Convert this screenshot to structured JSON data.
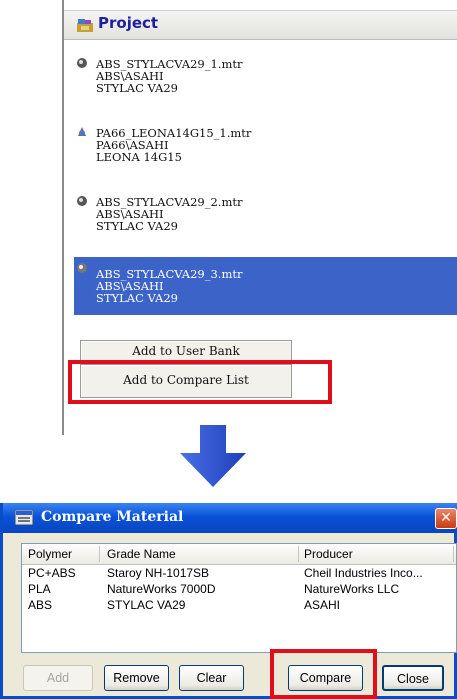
{
  "project": {
    "title": "Project",
    "items": [
      {
        "file": "ABS_STYLACVA29_1.mtr",
        "family": "ABS\\ASAHI",
        "grade": "STYLAC VA29",
        "selected": false
      },
      {
        "file": "PA66_LEONA14G15_1.mtr",
        "family": "PA66\\ASAHI",
        "grade": "LEONA 14G15",
        "selected": false
      },
      {
        "file": "ABS_STYLACVA29_2.mtr",
        "family": "ABS\\ASAHI",
        "grade": "STYLAC VA29",
        "selected": false
      },
      {
        "file": "ABS_STYLACVA29_3.mtr",
        "family": "ABS\\ASAHI",
        "grade": "STYLAC VA29",
        "selected": true
      }
    ],
    "context_menu": [
      "Add to User Bank",
      "Add to Compare List"
    ]
  },
  "dialog": {
    "title": "Compare Material",
    "close_glyph": "✕",
    "columns": [
      "Polymer",
      "Grade Name",
      "Producer"
    ],
    "rows": [
      [
        "PC+ABS",
        "Staroy NH-1017SB",
        "Cheil Industries Inco..."
      ],
      [
        "PLA",
        "NatureWorks 7000D",
        "NatureWorks LLC"
      ],
      [
        "ABS",
        "STYLAC VA29",
        "ASAHI"
      ]
    ],
    "buttons": {
      "add": "Add",
      "remove": "Remove",
      "clear": "Clear",
      "compare": "Compare",
      "close": "Close"
    }
  },
  "colors": {
    "selection": "#3b63c8",
    "highlight": "#e00d1a",
    "arrow": "#2a4fd0",
    "titlebar": "#0a52d8"
  },
  "icons": [
    "project-icon",
    "material-icon",
    "arrow-down-icon",
    "compare-material-icon",
    "close-icon"
  ]
}
